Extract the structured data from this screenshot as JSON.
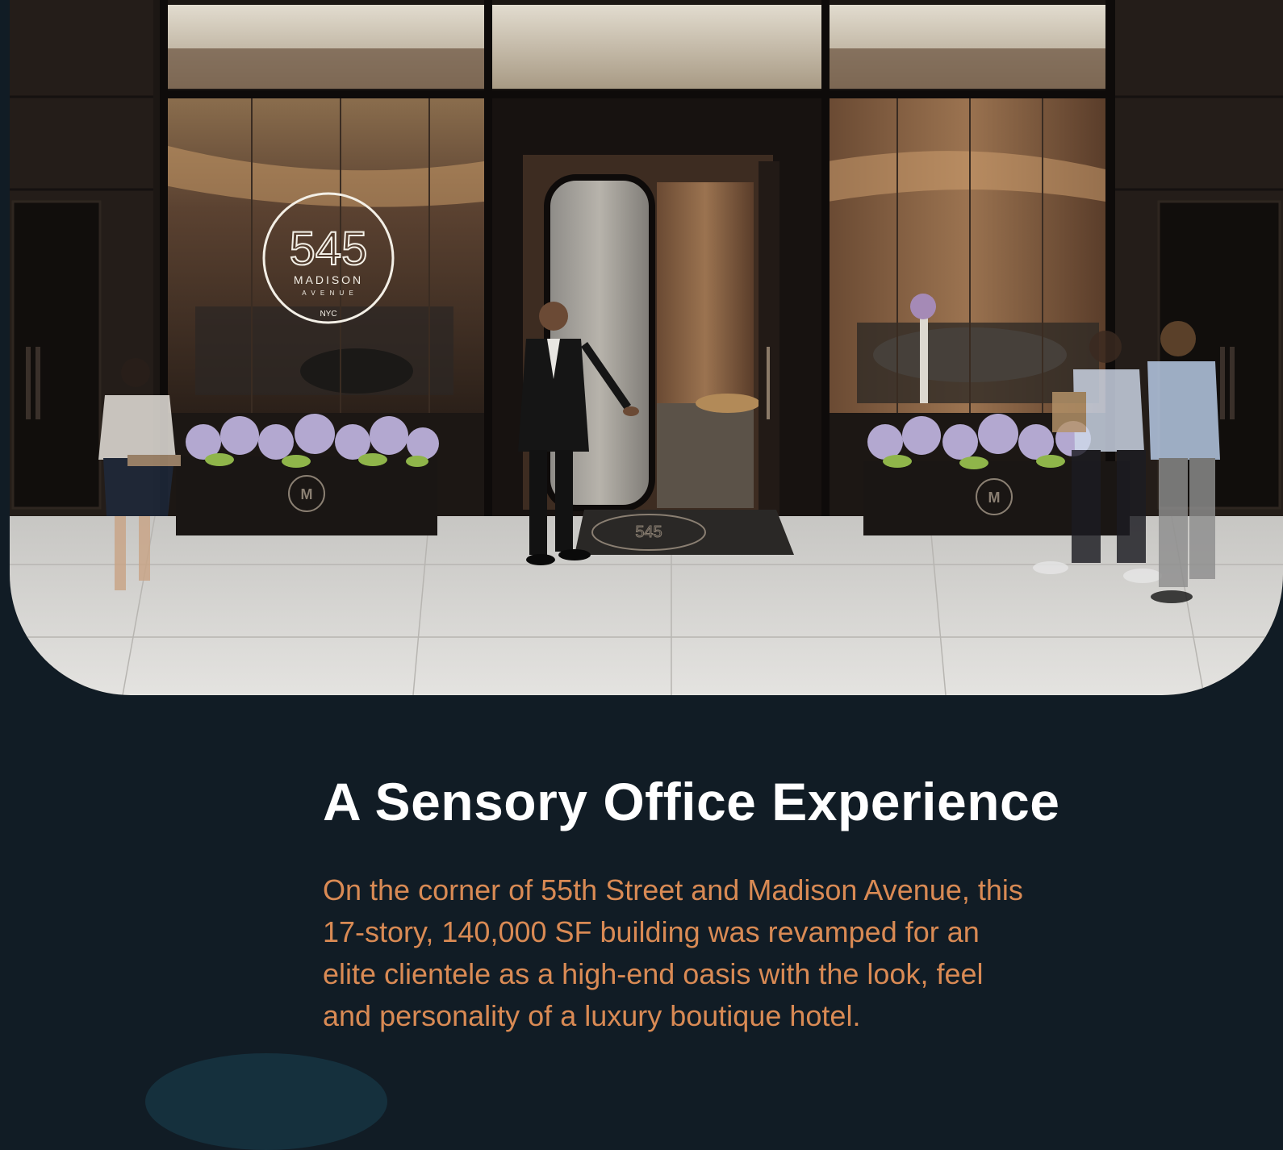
{
  "hero": {
    "signage": {
      "number": "545",
      "street": "MADISON",
      "avenue": "A V E N U E",
      "city": "NYC"
    },
    "planter_logo": "M",
    "mat_logo": "545"
  },
  "article": {
    "headline": "A Sensory Office Experience",
    "body_lines": [
      "On the corner of 55th Street and Madison Avenue, this",
      "17-story, 140,000 SF building was revamped for an",
      "elite clientele as a high-end oasis with the look, feel",
      "and personality of a luxury boutique hotel."
    ]
  },
  "colors": {
    "background": "#111c25",
    "headline": "#ffffff",
    "body": "#d98a54",
    "accent_arc": "#15303d"
  }
}
